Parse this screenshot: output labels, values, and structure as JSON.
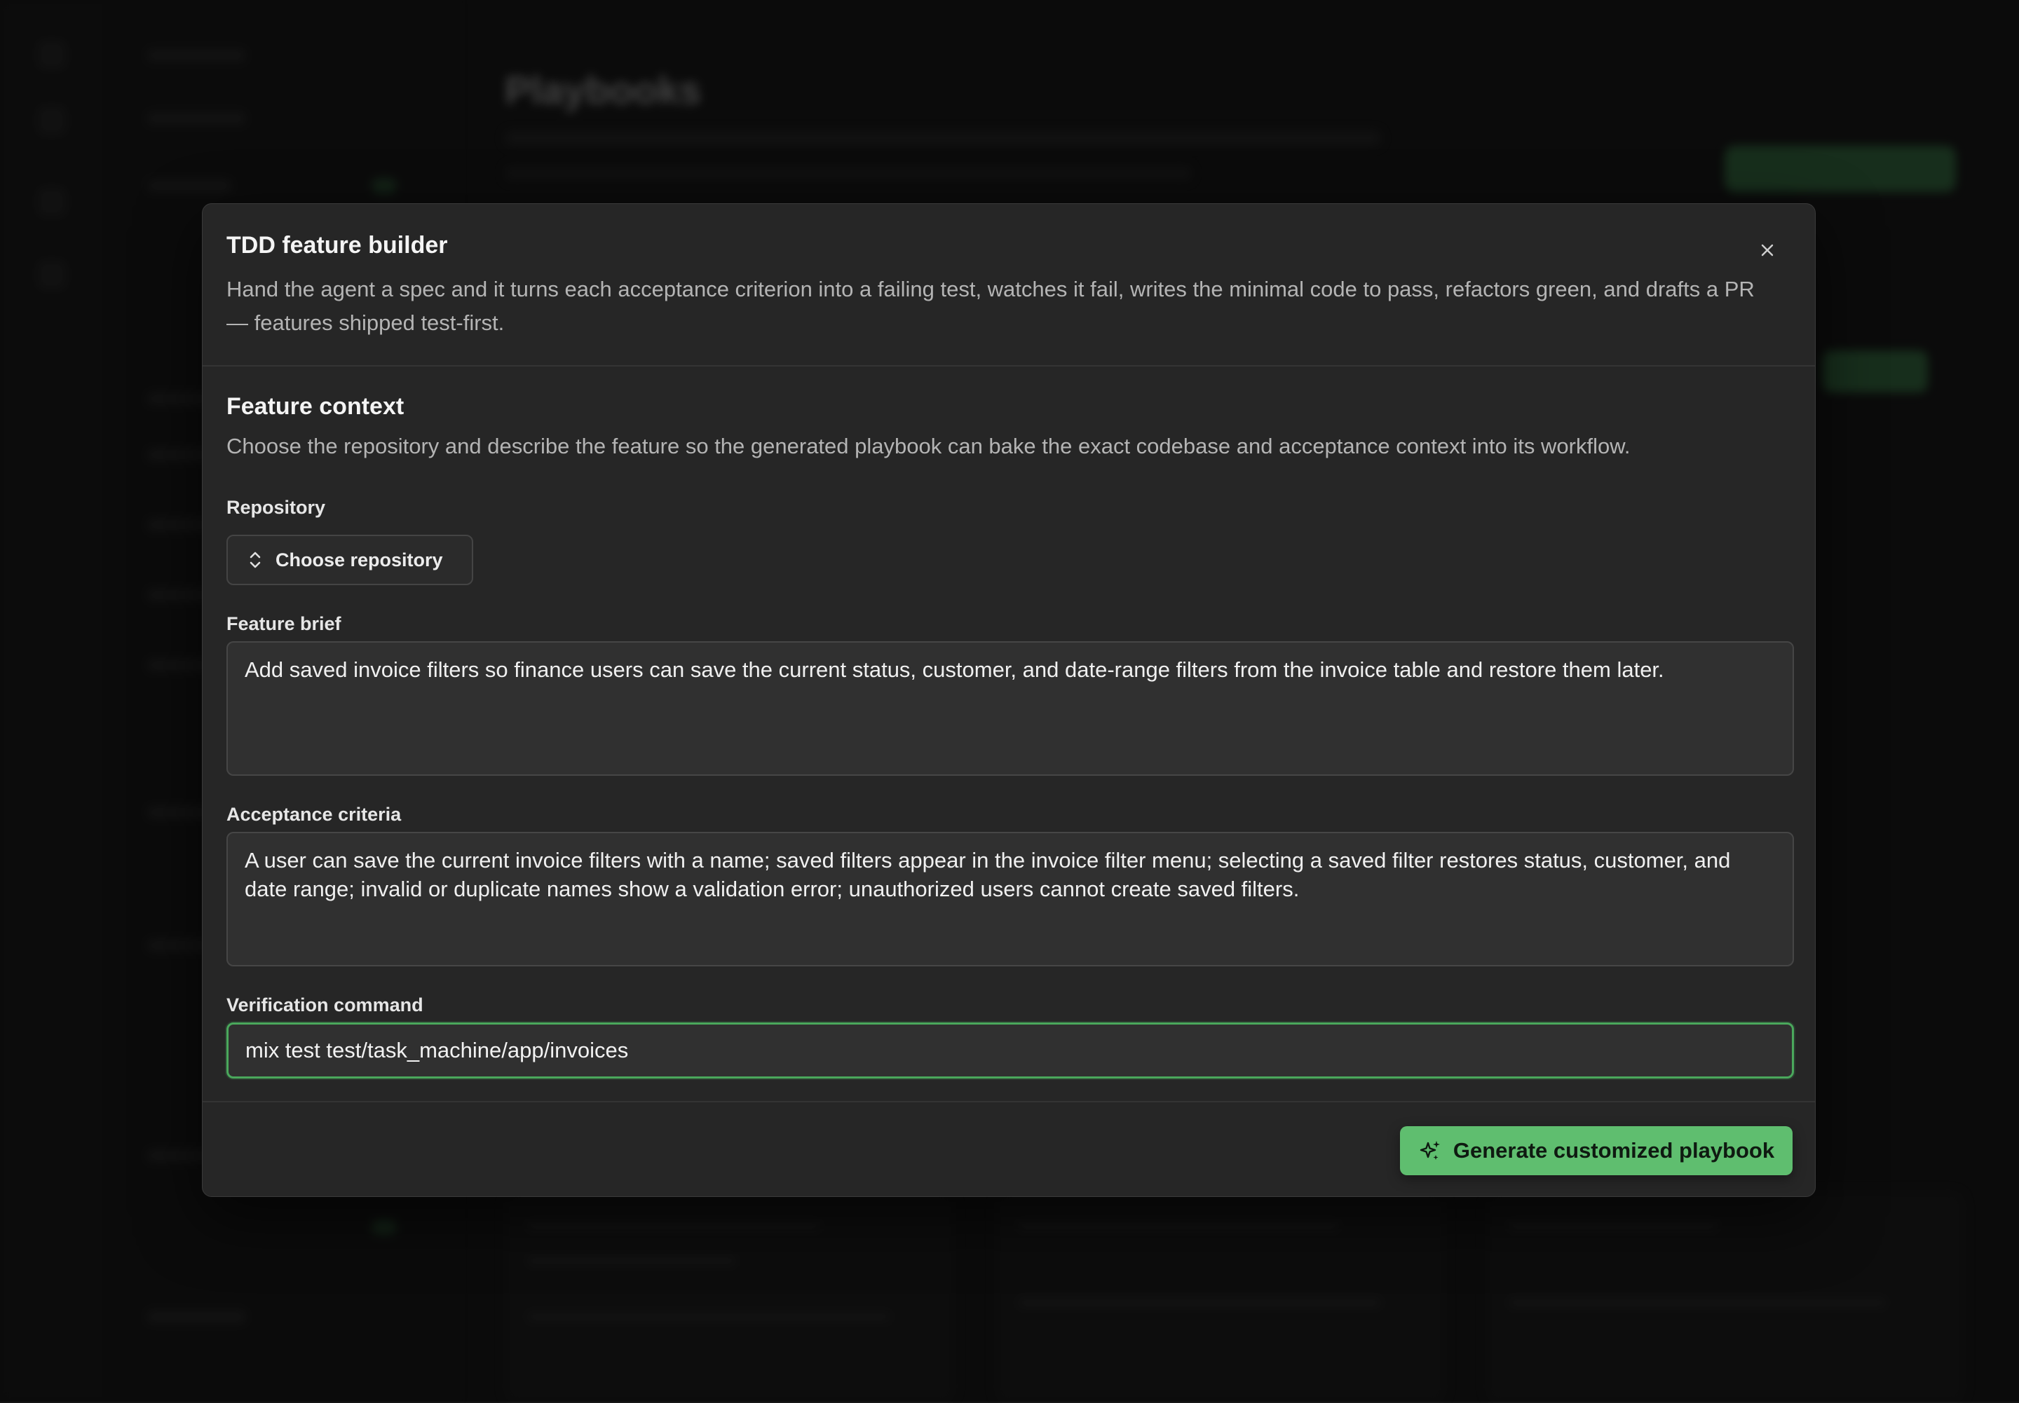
{
  "background": {
    "page_title": "Playbooks"
  },
  "modal": {
    "title": "TDD feature builder",
    "description": "Hand the agent a spec and it turns each acceptance criterion into a failing test, watches it fail, writes the minimal code to pass, refactors green, and drafts a PR — features shipped test-first.",
    "close_icon": "close-icon",
    "section": {
      "title": "Feature context",
      "description": "Choose the repository and describe the feature so the generated playbook can bake the exact codebase and acceptance context into its workflow."
    },
    "repository": {
      "label": "Repository",
      "button_label": "Choose repository",
      "icon": "chevron-up-down-icon"
    },
    "feature_brief": {
      "label": "Feature brief",
      "value": "Add saved invoice filters so finance users can save the current status, customer, and date-range filters from the invoice table and restore them later."
    },
    "acceptance_criteria": {
      "label": "Acceptance criteria",
      "value": "A user can save the current invoice filters with a name; saved filters appear in the invoice filter menu; selecting a saved filter restores status, customer, and date range; invalid or duplicate names show a validation error; unauthorized users cannot create saved filters."
    },
    "verification_command": {
      "label": "Verification command",
      "value": "mix test test/task_machine/app/invoices"
    },
    "generate_button": {
      "label": "Generate customized playbook",
      "icon": "sparkles-icon"
    }
  },
  "colors": {
    "accent_green": "#5fbe6f",
    "focus_ring": "#4aa85c",
    "modal_bg": "#262626",
    "page_bg": "#141414"
  }
}
